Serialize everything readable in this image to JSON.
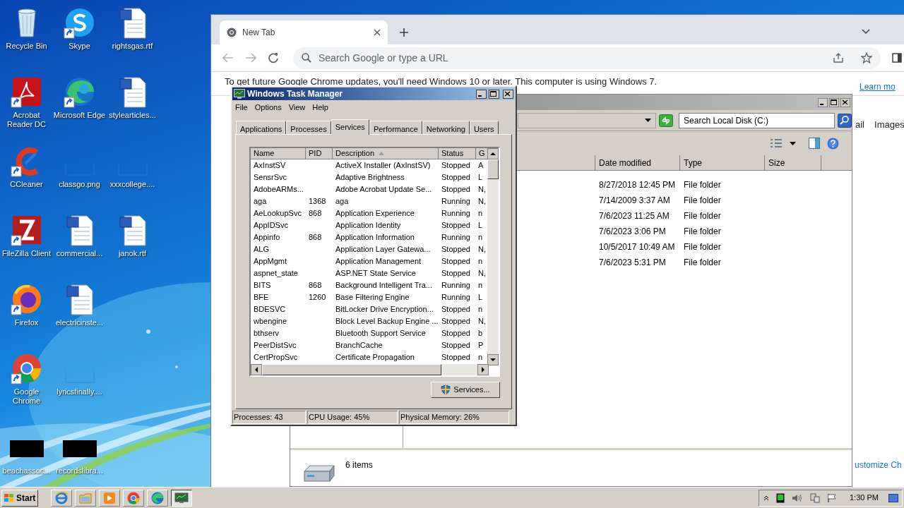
{
  "desktop": {
    "icon_rows": [
      [
        {
          "label": "Recycle Bin",
          "kind": "recycle",
          "shortcut": false
        },
        {
          "label": "Skype",
          "kind": "skype",
          "shortcut": true
        },
        {
          "label": "rightsgas.rtf",
          "kind": "word",
          "shortcut": false
        }
      ],
      [
        {
          "label": "Acrobat\nReader DC",
          "kind": "acrobat",
          "shortcut": true
        },
        {
          "label": "Microsoft Edge",
          "kind": "edge",
          "shortcut": true
        },
        {
          "label": "stylearticles...",
          "kind": "word",
          "shortcut": false
        }
      ],
      [
        {
          "label": "CCleaner",
          "kind": "ccleaner",
          "shortcut": true
        },
        {
          "label": "classgo.png",
          "kind": "blank",
          "shortcut": false
        },
        {
          "label": "xxxcollege....",
          "kind": "blank",
          "shortcut": false
        }
      ],
      [
        {
          "label": "FileZilla Client",
          "kind": "filezilla",
          "shortcut": true
        },
        {
          "label": "commercial...",
          "kind": "word",
          "shortcut": false
        },
        {
          "label": "janok.rtf",
          "kind": "word",
          "shortcut": false
        }
      ],
      [
        {
          "label": "Firefox",
          "kind": "firefox",
          "shortcut": true
        },
        {
          "label": "electricinste...",
          "kind": "word",
          "shortcut": false
        }
      ],
      [
        {
          "label": "Google\nChrome",
          "kind": "chrome",
          "shortcut": true
        },
        {
          "label": "lyricsfinally....",
          "kind": "blank",
          "shortcut": false
        }
      ],
      [
        {
          "label": "beachassoc...",
          "kind": "black",
          "shortcut": false
        },
        {
          "label": "recordslibra...",
          "kind": "black",
          "shortcut": false
        }
      ]
    ]
  },
  "browser": {
    "tabs": [
      {
        "label": "New Tab",
        "selected": true
      }
    ],
    "omnibox": {
      "placeholder": "Search Google or type a URL"
    },
    "infobar": {
      "text": "To get future Google Chrome updates, you'll need Windows 10 or later. This computer is using Windows 7.",
      "link": "Learn mo"
    },
    "page_texts": [
      "ail",
      "Images"
    ],
    "footer_link": "ustomize Ch"
  },
  "explorer": {
    "search": {
      "placeholder": "Search Local Disk (C:)"
    },
    "columns": [
      "Date modified",
      "Type",
      "Size"
    ],
    "rows": [
      {
        "date": "8/27/2018 12:45 PM",
        "type": "File folder"
      },
      {
        "date": "7/14/2009 3:37 AM",
        "type": "File folder"
      },
      {
        "date": "7/6/2023 11:25 AM",
        "type": "File folder"
      },
      {
        "date": "7/6/2023 3:06 PM",
        "type": "File folder"
      },
      {
        "date": "10/5/2017 10:49 AM",
        "type": "File folder"
      },
      {
        "date": "7/6/2023 5:31 PM",
        "type": "File folder"
      }
    ],
    "item_count": "6 items"
  },
  "task_manager": {
    "title": "Windows Task Manager",
    "menu": [
      "File",
      "Options",
      "View",
      "Help"
    ],
    "tabs": [
      {
        "label": "Applications",
        "selected": false
      },
      {
        "label": "Processes",
        "selected": false
      },
      {
        "label": "Services",
        "selected": true
      },
      {
        "label": "Performance",
        "selected": false
      },
      {
        "label": "Networking",
        "selected": false
      },
      {
        "label": "Users",
        "selected": false
      }
    ],
    "columns": [
      "Name",
      "PID",
      "Description",
      "Status",
      "G"
    ],
    "rows": [
      [
        "AxInstSV",
        "",
        "ActiveX Installer (AxInstSV)",
        "Stopped",
        "A"
      ],
      [
        "SensrSvc",
        "",
        "Adaptive Brightness",
        "Stopped",
        "L"
      ],
      [
        "AdobeARMs...",
        "",
        "Adobe Acrobat Update Se...",
        "Stopped",
        "N,"
      ],
      [
        "aga",
        "1368",
        "aga",
        "Running",
        "N,"
      ],
      [
        "AeLookupSvc",
        "868",
        "Application Experience",
        "Running",
        "n"
      ],
      [
        "AppIDSvc",
        "",
        "Application Identity",
        "Stopped",
        "L"
      ],
      [
        "Appinfo",
        "868",
        "Application Information",
        "Running",
        "n"
      ],
      [
        "ALG",
        "",
        "Application Layer Gatewa...",
        "Stopped",
        "N,"
      ],
      [
        "AppMgmt",
        "",
        "Application Management",
        "Stopped",
        "n"
      ],
      [
        "aspnet_state",
        "",
        "ASP.NET State Service",
        "Stopped",
        "N,"
      ],
      [
        "BITS",
        "868",
        "Background Intelligent Tra...",
        "Running",
        "n"
      ],
      [
        "BFE",
        "1260",
        "Base Filtering Engine",
        "Running",
        "L"
      ],
      [
        "BDESVC",
        "",
        "BitLocker Drive Encryption...",
        "Stopped",
        "n"
      ],
      [
        "wbengine",
        "",
        "Block Level Backup Engine ...",
        "Stopped",
        "N,"
      ],
      [
        "bthserv",
        "",
        "Bluetooth Support Service",
        "Stopped",
        "b"
      ],
      [
        "PeerDistSvc",
        "",
        "BranchCache",
        "Stopped",
        "P"
      ],
      [
        "CertPropSvc",
        "",
        "Certificate Propagation",
        "Stopped",
        "n"
      ]
    ],
    "services_button": "Services...",
    "status": [
      "Processes: 43",
      "CPU Usage: 45%",
      "Physical Memory: 26%"
    ]
  },
  "taskbar": {
    "start": "Start",
    "apps": [
      {
        "kind": "ie",
        "active": false
      },
      {
        "kind": "folder",
        "active": false
      },
      {
        "kind": "media",
        "active": false
      },
      {
        "kind": "chrome",
        "active": false
      },
      {
        "kind": "edge",
        "active": false
      },
      {
        "kind": "taskmgr",
        "active": true
      }
    ],
    "clock": "1:30 PM"
  }
}
